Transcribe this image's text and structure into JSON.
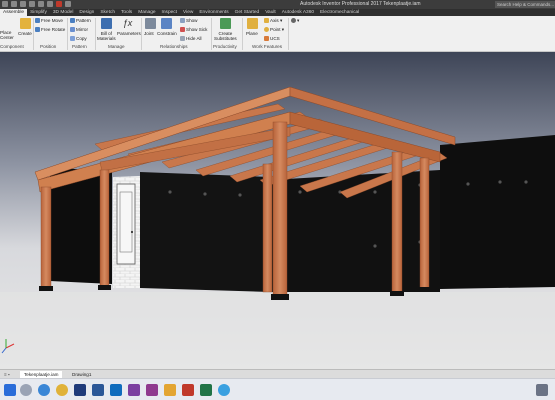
{
  "window": {
    "title": "Autodesk Inventor Professional 2017    Tekenplaatje.iam",
    "search_placeholder": "Search Help & Commands..."
  },
  "tabs": [
    {
      "label": "Assemble",
      "active": true
    },
    {
      "label": "Simplify"
    },
    {
      "label": "3D Model"
    },
    {
      "label": "Design"
    },
    {
      "label": "Sketch"
    },
    {
      "label": "Tools"
    },
    {
      "label": "Manage"
    },
    {
      "label": "Inspect"
    },
    {
      "label": "View"
    },
    {
      "label": "Environments"
    },
    {
      "label": "Get Started"
    },
    {
      "label": "Vault"
    },
    {
      "label": "Autodesk A360"
    },
    {
      "label": "Electromechanical"
    }
  ],
  "ribbon": {
    "component": {
      "place": "Place",
      "center": "Center",
      "create": "Create",
      "group": "Component"
    },
    "position": {
      "free_move": "Free Move",
      "free_rotate": "Free Rotate",
      "group": "Position"
    },
    "pattern": {
      "pattern": "Pattern",
      "mirror": "Mirror",
      "copy": "Copy",
      "group": "Pattern"
    },
    "manage": {
      "bom_line1": "Bill of",
      "bom_line2": "Materials",
      "parameters": "Parameters",
      "group": "Manage"
    },
    "relationships": {
      "joint": "Joint",
      "constrain": "Constrain",
      "show": "Show",
      "show_sick": "Show Sick",
      "hide_all": "Hide All",
      "group": "Relationships"
    },
    "productivity": {
      "create_line1": "Create",
      "create_line2": "Substitutes",
      "group": "Productivity"
    },
    "work_features": {
      "plane": "Plane",
      "axis": "Axis",
      "point": "Point",
      "ucs": "UCS",
      "group": "Work Features"
    }
  },
  "document_tabs": [
    {
      "label": "Tekenplaatje.iam",
      "active": true
    },
    {
      "label": "Drawing1"
    }
  ],
  "taskbar_icons": [
    "start",
    "search-taskbar",
    "ie",
    "chrome",
    "explorer",
    "photoshop",
    "word",
    "outlook",
    "onenote",
    "folder",
    "inventor",
    "excel",
    "skype",
    "misc"
  ],
  "colors": {
    "titlebar": "#3c3c3c",
    "ribbon": "#f0f0f0",
    "wood": "#c9774b",
    "wall": "#101010",
    "sky_top": "#3e4557",
    "floor": "#dedede"
  }
}
